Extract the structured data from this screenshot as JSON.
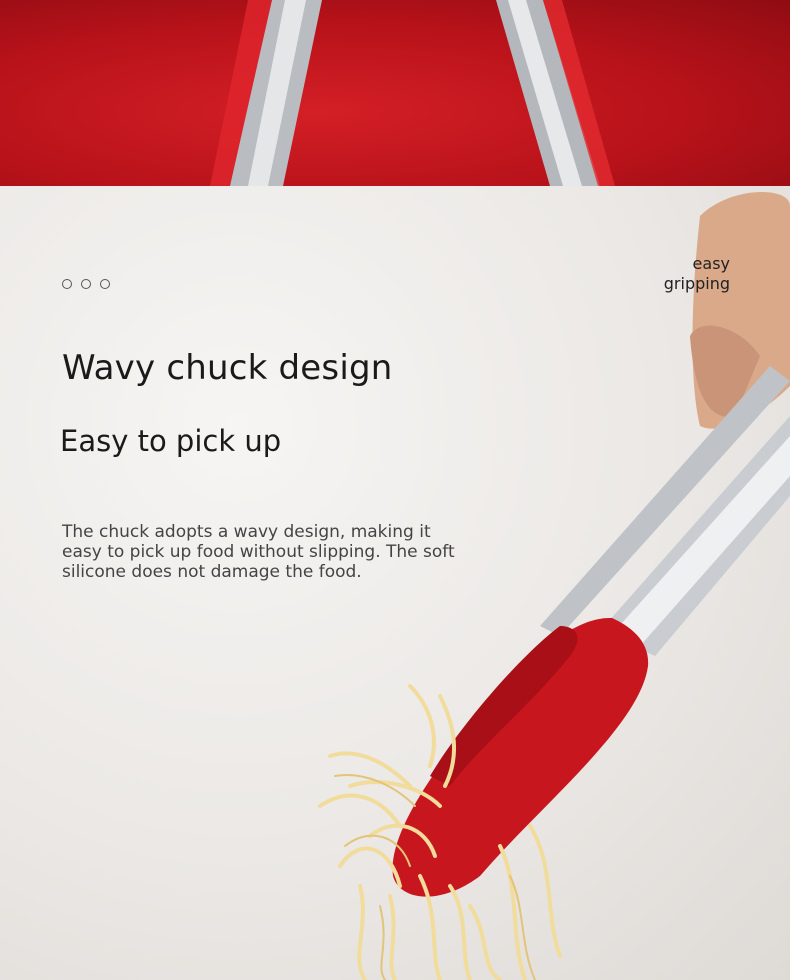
{
  "banner": {
    "image_alt": "red silicone tongs with stainless steel arms on red background"
  },
  "indicator": {
    "dot_count": 3
  },
  "side_label": {
    "line1": "easy",
    "line2": "gripping"
  },
  "headline": {
    "title": "Wavy chuck design",
    "subtitle": "Easy to pick up"
  },
  "description": {
    "text": "The chuck adopts a wavy design, making it easy to pick up food without slipping. The soft silicone does not damage the food."
  },
  "colors": {
    "accent_red": "#c8161e",
    "steel": "#c9ccd0",
    "noodle": "#f3e2a6"
  }
}
